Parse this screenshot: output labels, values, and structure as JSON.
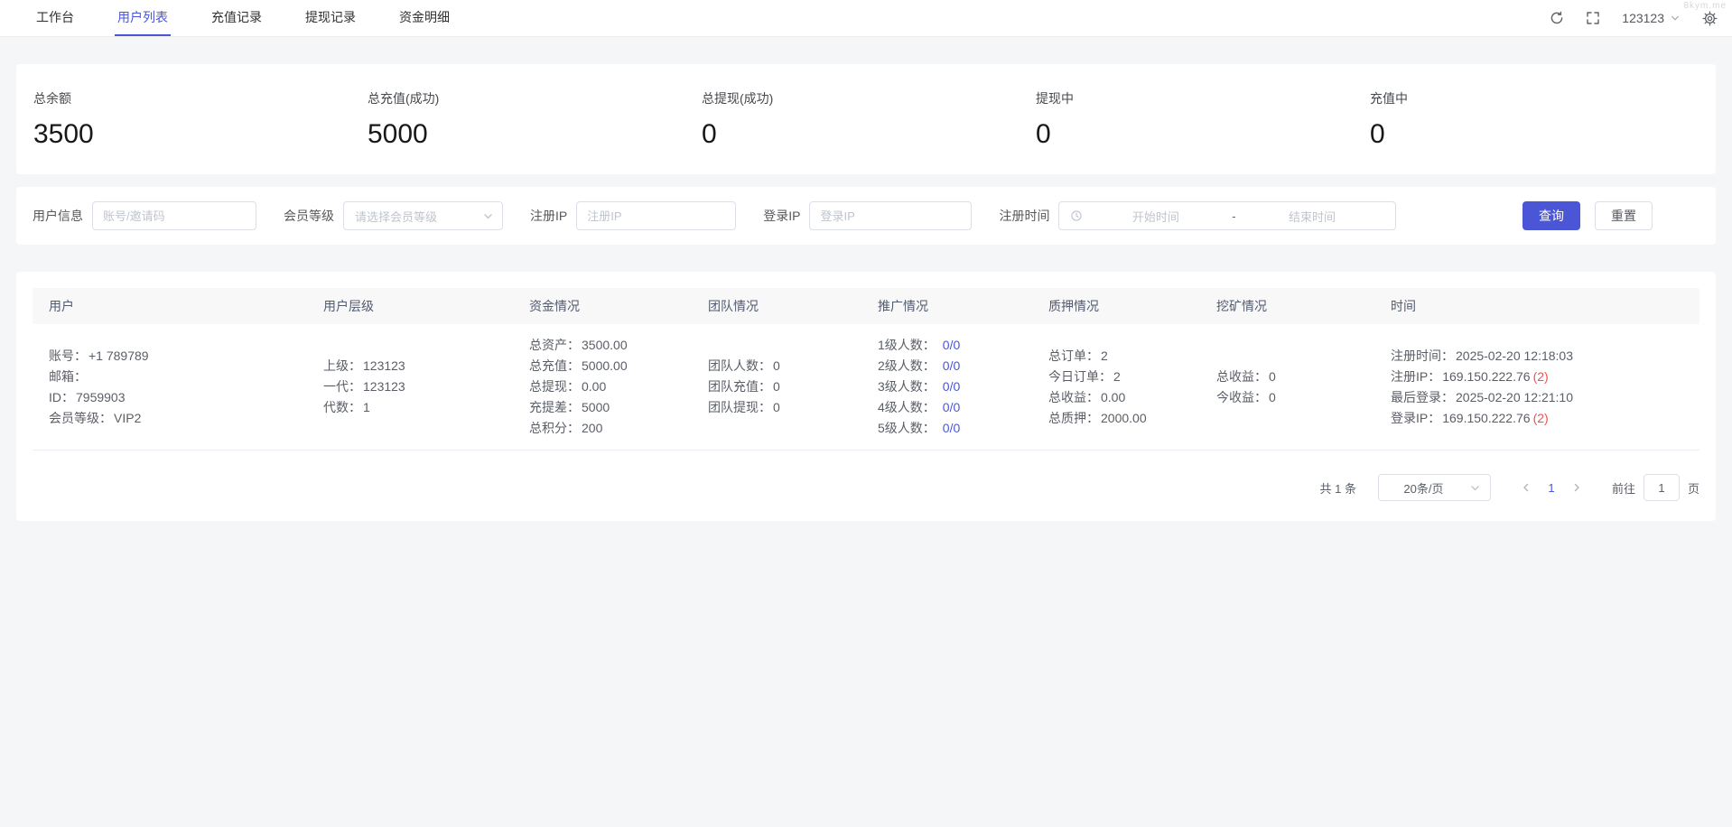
{
  "watermark": "8kym.me",
  "header": {
    "tabs": [
      {
        "label": "工作台",
        "active": false
      },
      {
        "label": "用户列表",
        "active": true
      },
      {
        "label": "充值记录",
        "active": false
      },
      {
        "label": "提现记录",
        "active": false
      },
      {
        "label": "资金明细",
        "active": false
      }
    ],
    "username": "123123"
  },
  "stats": [
    {
      "label": "总余额",
      "value": "3500"
    },
    {
      "label": "总充值(成功)",
      "value": "5000"
    },
    {
      "label": "总提现(成功)",
      "value": "0"
    },
    {
      "label": "提现中",
      "value": "0"
    },
    {
      "label": "充值中",
      "value": "0"
    }
  ],
  "filters": {
    "user_info_label": "用户信息",
    "user_info_placeholder": "账号/邀请码",
    "level_label": "会员等级",
    "level_placeholder": "请选择会员等级",
    "reg_ip_label": "注册IP",
    "reg_ip_placeholder": "注册IP",
    "login_ip_label": "登录IP",
    "login_ip_placeholder": "登录IP",
    "reg_time_label": "注册时间",
    "start_placeholder": "开始时间",
    "separator": "-",
    "end_placeholder": "结束时间",
    "search_button": "查询",
    "reset_button": "重置"
  },
  "table": {
    "columns": [
      "用户",
      "用户层级",
      "资金情况",
      "团队情况",
      "推广情况",
      "质押情况",
      "挖矿情况",
      "时间"
    ],
    "row": {
      "user": [
        {
          "label": "账号：",
          "value": "+1 789789"
        },
        {
          "label": "邮箱：",
          "value": ""
        },
        {
          "label": "ID：",
          "value": "7959903"
        },
        {
          "label": "会员等级：",
          "value": "VIP2"
        }
      ],
      "hierarchy": [
        {
          "label": "上级：",
          "value": "123123"
        },
        {
          "label": "一代：",
          "value": "123123"
        },
        {
          "label": "代数：",
          "value": "1"
        }
      ],
      "funds": [
        {
          "label": "总资产：",
          "value": "3500.00"
        },
        {
          "label": "总充值：",
          "value": "5000.00"
        },
        {
          "label": "总提现：",
          "value": "0.00"
        },
        {
          "label": "充提差：",
          "value": "5000"
        },
        {
          "label": "总积分：",
          "value": "200"
        }
      ],
      "team": [
        {
          "label": "团队人数：",
          "value": "0"
        },
        {
          "label": "团队充值：",
          "value": "0"
        },
        {
          "label": "团队提现：",
          "value": "0"
        }
      ],
      "promo": [
        {
          "label": "1级人数：",
          "value": "0/0"
        },
        {
          "label": "2级人数：",
          "value": "0/0"
        },
        {
          "label": "3级人数：",
          "value": "0/0"
        },
        {
          "label": "4级人数：",
          "value": "0/0"
        },
        {
          "label": "5级人数：",
          "value": "0/0"
        }
      ],
      "pledge": [
        {
          "label": "总订单：",
          "value": "2"
        },
        {
          "label": "今日订单：",
          "value": "2"
        },
        {
          "label": "总收益：",
          "value": "0.00"
        },
        {
          "label": "总质押：",
          "value": "2000.00"
        }
      ],
      "mining": [
        {
          "label": "总收益：",
          "value": "0"
        },
        {
          "label": "今收益：",
          "value": "0"
        }
      ],
      "time": [
        {
          "label": "注册时间：",
          "value": "2025-02-20 12:18:03",
          "suffix": ""
        },
        {
          "label": "注册IP：",
          "value": "169.150.222.76",
          "suffix": "(2)"
        },
        {
          "label": "最后登录：",
          "value": "2025-02-20 12:21:10",
          "suffix": ""
        },
        {
          "label": "登录IP：",
          "value": "169.150.222.76",
          "suffix": "(2)"
        }
      ]
    }
  },
  "pagination": {
    "total": "共 1 条",
    "page_size": "20条/页",
    "current_page": "1",
    "goto_label": "前往",
    "goto_value": "1",
    "page_suffix": "页"
  },
  "colors": {
    "primary": "#4a56d6",
    "danger": "#f24f4f"
  }
}
